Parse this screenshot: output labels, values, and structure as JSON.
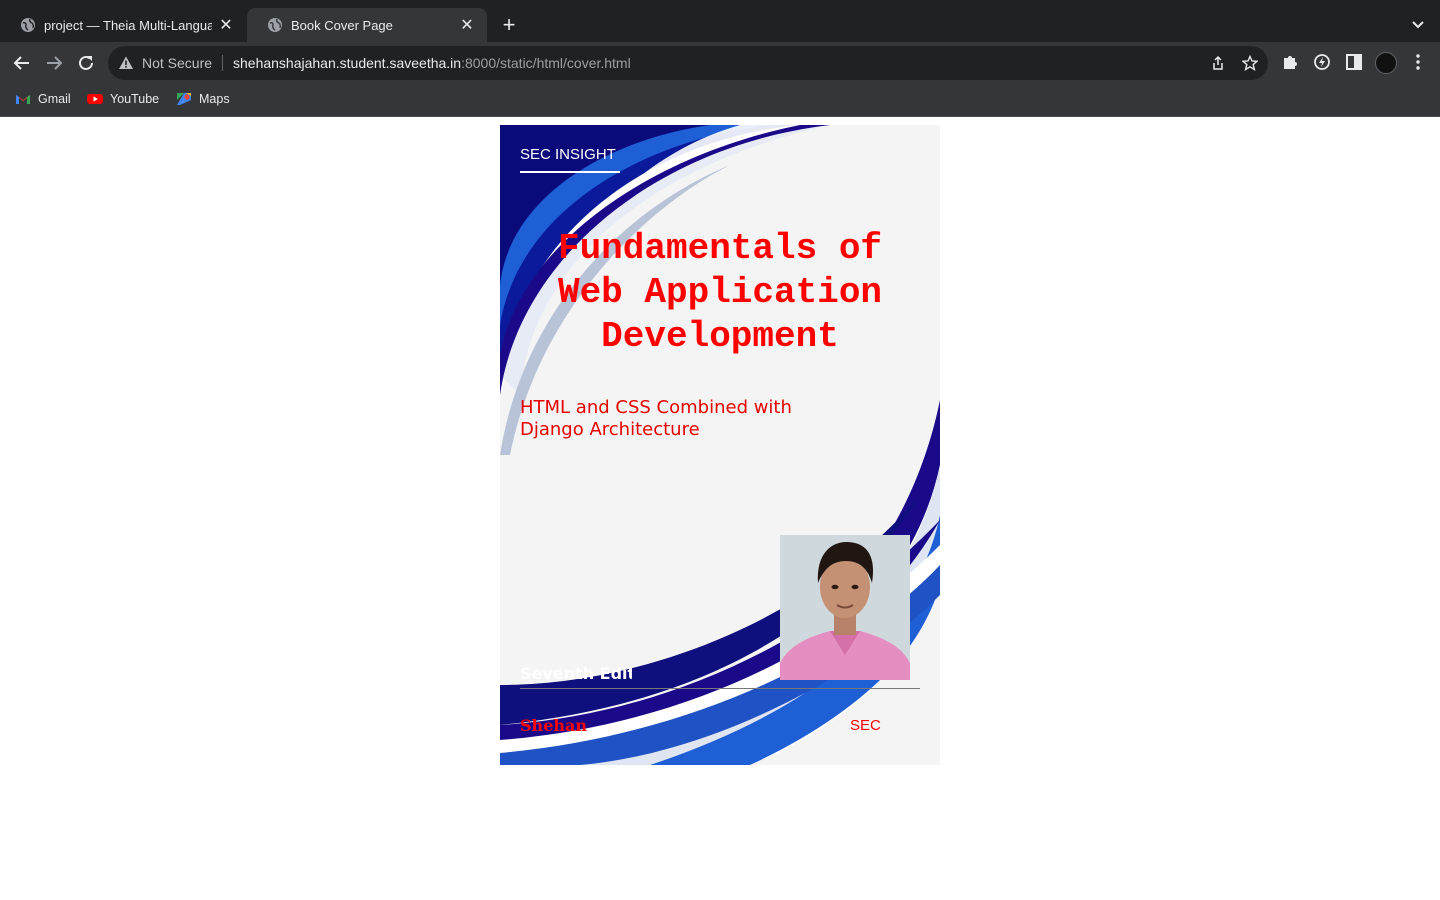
{
  "browser": {
    "tabs": [
      {
        "title": "project — Theia Multi-Languag",
        "active": false
      },
      {
        "title": "Book Cover Page",
        "active": true
      }
    ],
    "omnibox": {
      "security_label": "Not Secure",
      "url_host": "shehanshajahan.student.saveetha.in",
      "url_path": ":8000/static/html/cover.html"
    },
    "bookmarks": [
      {
        "label": "Gmail",
        "icon": "gmail-icon"
      },
      {
        "label": "YouTube",
        "icon": "youtube-icon"
      },
      {
        "label": "Maps",
        "icon": "maps-icon"
      }
    ]
  },
  "cover": {
    "publisher": "SEC INSIGHT",
    "title_lines": [
      "Fundamentals of",
      "Web Application",
      "Development"
    ],
    "subtitle": "HTML and CSS Combined with Django Architecture",
    "edition": "Seventh Edition",
    "author": "Shehan",
    "organization": "SEC",
    "colors": {
      "title": "#ff0000",
      "swoosh_dark": "#1a0a8a",
      "swoosh_blue": "#1e5fd6",
      "background": "#f4f4f4"
    }
  }
}
